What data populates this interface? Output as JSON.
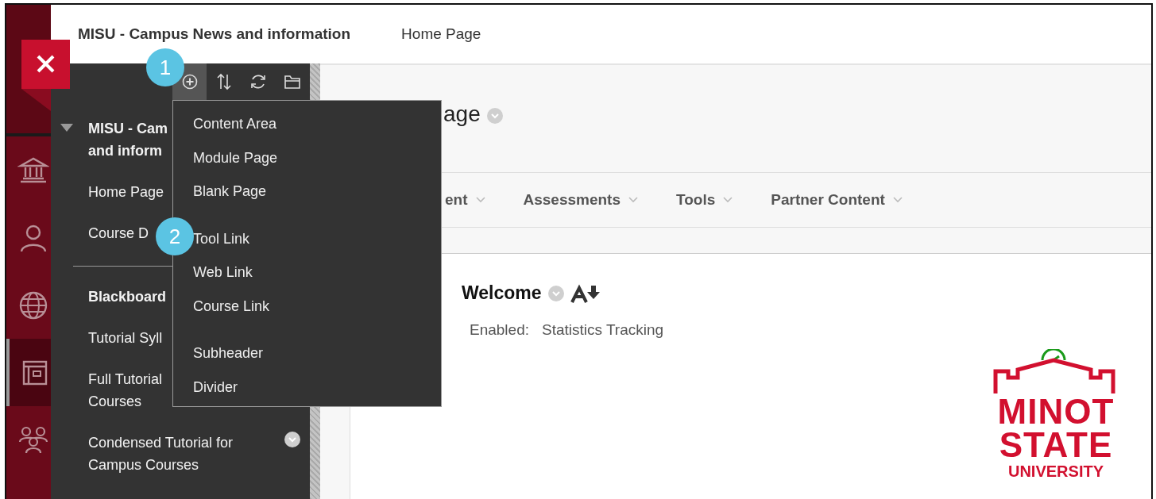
{
  "header": {
    "course_title": "MISU - Campus News and information",
    "breadcrumb": "Home Page"
  },
  "rail": [
    {
      "kind": "institution",
      "selected": false
    },
    {
      "kind": "person",
      "selected": false
    },
    {
      "kind": "globe",
      "selected": false
    },
    {
      "kind": "content",
      "selected": true
    },
    {
      "kind": "group",
      "selected": false
    }
  ],
  "toolbar": [
    {
      "kind": "add",
      "selected": true
    },
    {
      "kind": "sort",
      "selected": false
    },
    {
      "kind": "refresh",
      "selected": false
    },
    {
      "kind": "folder",
      "selected": false
    }
  ],
  "sidebar": {
    "items": [
      {
        "kind": "heading",
        "lines": [
          "MISU - Cam",
          "and inform"
        ],
        "expanded": true
      },
      {
        "kind": "link",
        "lines": [
          "Home Page"
        ]
      },
      {
        "kind": "link",
        "lines": [
          "Course D"
        ]
      },
      {
        "kind": "divider"
      },
      {
        "kind": "subheader",
        "lines": [
          "Blackboard"
        ]
      },
      {
        "kind": "link",
        "lines": [
          "Tutorial Syll"
        ]
      },
      {
        "kind": "link",
        "lines": [
          "Full Tutorial",
          "Courses"
        ]
      },
      {
        "kind": "link",
        "lines": [
          "Condensed Tutorial for",
          "Campus Courses"
        ],
        "menu": true
      }
    ]
  },
  "menu": {
    "groups": [
      [
        "Content Area",
        "Module Page",
        "Blank Page"
      ],
      [
        "Tool Link",
        "Web Link",
        "Course Link"
      ],
      [
        "Subheader",
        "Divider"
      ]
    ]
  },
  "callouts": [
    "1",
    "2"
  ],
  "page": {
    "title": "age",
    "nav": [
      "ent",
      "Assessments",
      "Tools",
      "Partner Content"
    ]
  },
  "content": {
    "heading": "Welcome",
    "status_label": "Enabled:",
    "status_value": "Statistics Tracking",
    "logo": [
      "MINOT",
      "STATE",
      "UNIVERSITY"
    ]
  }
}
